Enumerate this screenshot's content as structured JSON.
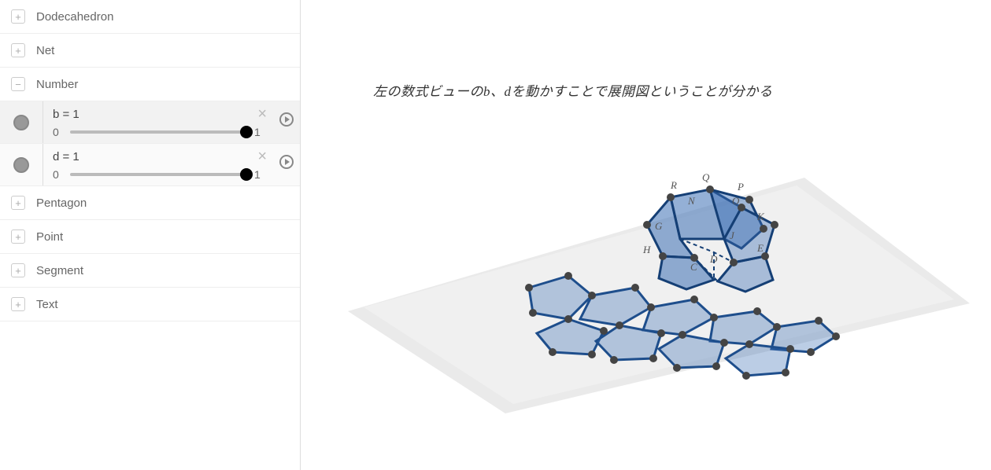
{
  "sidebar": {
    "categories": [
      {
        "label": "Dodecahedron",
        "expanded": false,
        "icon": "+"
      },
      {
        "label": "Net",
        "expanded": false,
        "icon": "+"
      },
      {
        "label": "Number",
        "expanded": true,
        "icon": "−"
      },
      {
        "label": "Pentagon",
        "expanded": false,
        "icon": "+"
      },
      {
        "label": "Point",
        "expanded": false,
        "icon": "+"
      },
      {
        "label": "Segment",
        "expanded": false,
        "icon": "+"
      },
      {
        "label": "Text",
        "expanded": false,
        "icon": "+"
      }
    ],
    "sliders": [
      {
        "name": "b",
        "value": 1,
        "min": 0,
        "max": 1,
        "label": "b = 1"
      },
      {
        "name": "d",
        "value": 1,
        "min": 0,
        "max": 1,
        "label": "d = 1"
      }
    ]
  },
  "canvas": {
    "caption_parts": [
      "左の数式ビューの",
      "b",
      "、",
      "d",
      "を動かすことで展開図ということが分かる"
    ],
    "vertex_labels": [
      "R",
      "Q",
      "P",
      "N",
      "O",
      "K",
      "G",
      "J",
      "E",
      "H",
      "D",
      "C"
    ]
  }
}
